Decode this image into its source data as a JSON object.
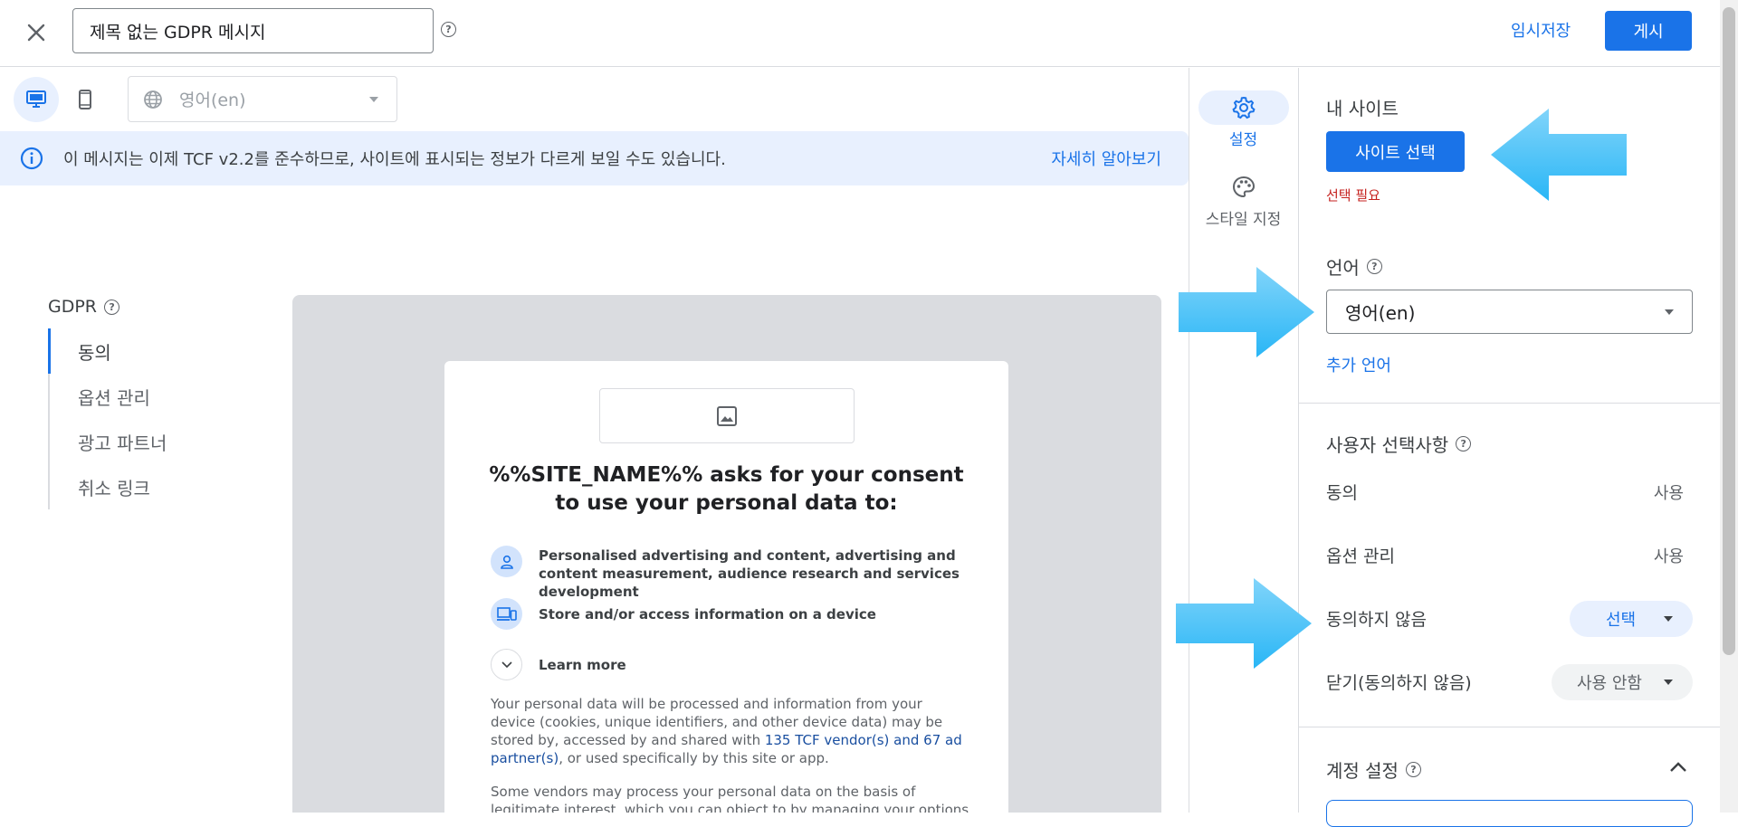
{
  "header": {
    "title_value": "제목 없는 GDPR 메시지",
    "draft_label": "임시저장",
    "publish_label": "게시"
  },
  "toolbar": {
    "language_value": "영어(en)"
  },
  "banner": {
    "text": "이 메시지는 이제 TCF v2.2를 준수하므로, 사이트에 표시되는 정보가 다르게 보일 수도 있습니다.",
    "link": "자세히 알아보기"
  },
  "left_nav": {
    "heading": "GDPR",
    "items": [
      {
        "label": "동의"
      },
      {
        "label": "옵션 관리"
      },
      {
        "label": "광고 파트너"
      },
      {
        "label": "취소 링크"
      }
    ]
  },
  "preview": {
    "title": "%%SITE_NAME%% asks for your consent to use your personal data to:",
    "purposes": [
      {
        "icon": "person-icon",
        "text": "Personalised advertising and content, advertising and content measurement, audience research and services development"
      },
      {
        "icon": "devices-icon",
        "text": "Store and/or access information on a device"
      },
      {
        "icon": "chevron-down-icon",
        "text": "Learn more"
      }
    ],
    "para1_a": "Your personal data will be processed and information from your device (cookies, unique identifiers, and other device data) may be stored by, accessed by and shared with ",
    "para1_link": "135 TCF vendor(s) and 67 ad partner(s)",
    "para1_b": ", or used specifically by this site or app.",
    "para2": "Some vendors may process your personal data on the basis of legitimate interest, which you can object to by managing your options below. Look"
  },
  "side_tabs": {
    "settings": "설정",
    "style": "스타일 지정"
  },
  "right_panel": {
    "my_site_label": "내 사이트",
    "site_select_btn": "사이트 선택",
    "required": "선택 필요",
    "language_label": "언어",
    "language_value": "영어(en)",
    "add_language": "추가 언어",
    "user_choices_label": "사용자 선택사항",
    "choices": [
      {
        "label": "동의",
        "value": "사용"
      },
      {
        "label": "옵션 관리",
        "value": "사용"
      },
      {
        "label": "동의하지 않음",
        "value": "선택"
      },
      {
        "label": "닫기(동의하지 않음)",
        "value": "사용 안함"
      }
    ],
    "account_settings_label": "계정 설정"
  },
  "colors": {
    "accent": "#1a73e8",
    "arrow": "#4fc3f7",
    "banner_bg": "#e8f0fe",
    "error": "#c5221f"
  }
}
